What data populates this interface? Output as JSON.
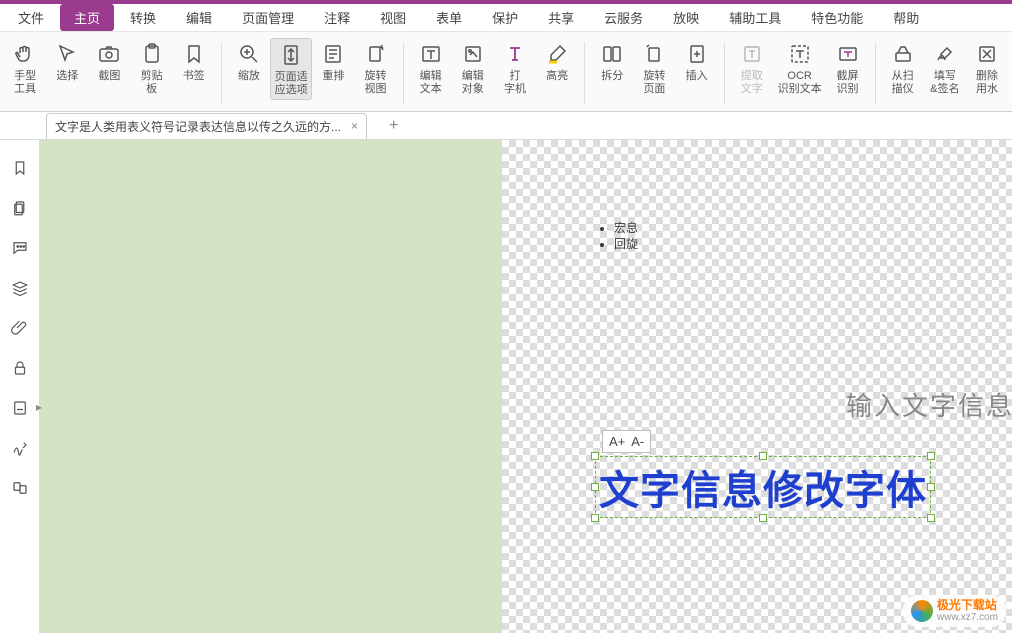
{
  "accent_color": "#9b3b8f",
  "menu": {
    "items": [
      {
        "label": "文件"
      },
      {
        "label": "主页"
      },
      {
        "label": "转换"
      },
      {
        "label": "编辑"
      },
      {
        "label": "页面管理"
      },
      {
        "label": "注释"
      },
      {
        "label": "视图"
      },
      {
        "label": "表单"
      },
      {
        "label": "保护"
      },
      {
        "label": "共享"
      },
      {
        "label": "云服务"
      },
      {
        "label": "放映"
      },
      {
        "label": "辅助工具"
      },
      {
        "label": "特色功能"
      },
      {
        "label": "帮助"
      }
    ],
    "active_index": 1
  },
  "ribbon": [
    {
      "label": "手型\n工具",
      "icon": "hand"
    },
    {
      "label": "选择",
      "icon": "cursor",
      "drop": true
    },
    {
      "label": "截图",
      "icon": "snapshot"
    },
    {
      "label": "剪贴\n板",
      "icon": "clipboard",
      "drop": true
    },
    {
      "label": "书签",
      "icon": "bookmark"
    },
    {
      "label": "缩放",
      "icon": "zoom",
      "drop": true
    },
    {
      "label": "页面适\n应选项",
      "icon": "fit",
      "drop": true,
      "active": true
    },
    {
      "label": "重排",
      "icon": "reflow"
    },
    {
      "label": "旋转\n视图",
      "icon": "rotate-view",
      "drop": true
    },
    {
      "label": "编辑\n文本",
      "icon": "edit-text"
    },
    {
      "label": "编辑\n对象",
      "icon": "edit-object",
      "drop": true
    },
    {
      "label": "打\n字机",
      "icon": "typewriter"
    },
    {
      "label": "高亮",
      "icon": "highlight"
    },
    {
      "label": "拆分",
      "icon": "split",
      "drop": true
    },
    {
      "label": "旋转\n页面",
      "icon": "rotate-page",
      "drop": true
    },
    {
      "label": "插入",
      "icon": "insert",
      "drop": true
    },
    {
      "label": "提取\n文字",
      "icon": "extract-text",
      "disabled": true
    },
    {
      "label": "OCR\n识别文本",
      "icon": "ocr"
    },
    {
      "label": "截屏\n识别",
      "icon": "screenshot-ocr"
    },
    {
      "label": "从扫\n描仪",
      "icon": "scanner",
      "drop": true
    },
    {
      "label": "填写\n&签名",
      "icon": "fill-sign"
    },
    {
      "label": "删除\n用水",
      "icon": "remove-wm"
    }
  ],
  "doctab": {
    "title": "文字是人类用表义符号记录表达信息以传之久远的方...",
    "close": "×"
  },
  "addtab": "+",
  "page_content": {
    "bullets": [
      "宏息",
      "回旋"
    ],
    "faded_text": "输入文字信息",
    "size_controls": {
      "inc": "A+",
      "dec": "A-"
    },
    "big_text": "文字信息修改字体"
  },
  "watermark": {
    "brand": "极光下载站",
    "url": "www.xz7.com"
  }
}
